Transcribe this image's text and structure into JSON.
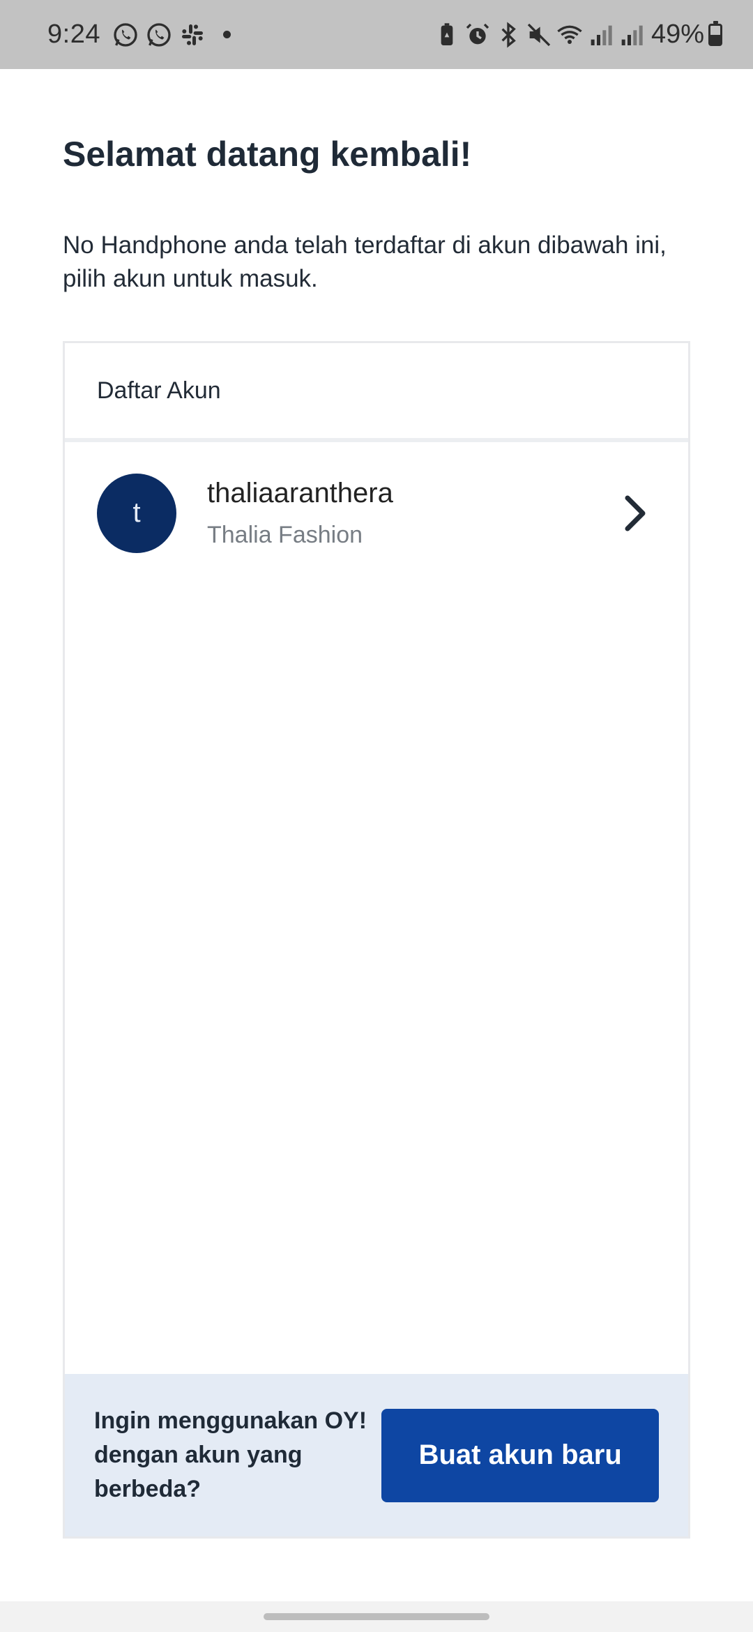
{
  "status_bar": {
    "time": "9:24",
    "left_icons": [
      "whatsapp-icon",
      "whatsapp-icon",
      "slack-icon",
      "dot"
    ],
    "right_icons": [
      "battery-saver-icon",
      "alarm-icon",
      "bluetooth-icon",
      "mute-icon",
      "wifi-icon",
      "signal-icon",
      "signal-icon"
    ],
    "battery_percent": "49%",
    "battery_level": 0.49
  },
  "page": {
    "title": "Selamat datang kembali!",
    "description": "No Handphone anda telah terdaftar di akun dibawah ini, pilih akun untuk masuk."
  },
  "account_list": {
    "header": "Daftar Akun",
    "accounts": [
      {
        "avatar_initial": "t",
        "username": "thaliaaranthera",
        "name": "Thalia Fashion"
      }
    ]
  },
  "footer": {
    "prompt": "Ingin menggunakan OY! dengan akun yang berbeda?",
    "create_button_label": "Buat akun baru"
  },
  "colors": {
    "primary": "#0e46a3",
    "avatar_bg": "#0b2c63",
    "footer_bg": "#e4ebf5"
  }
}
